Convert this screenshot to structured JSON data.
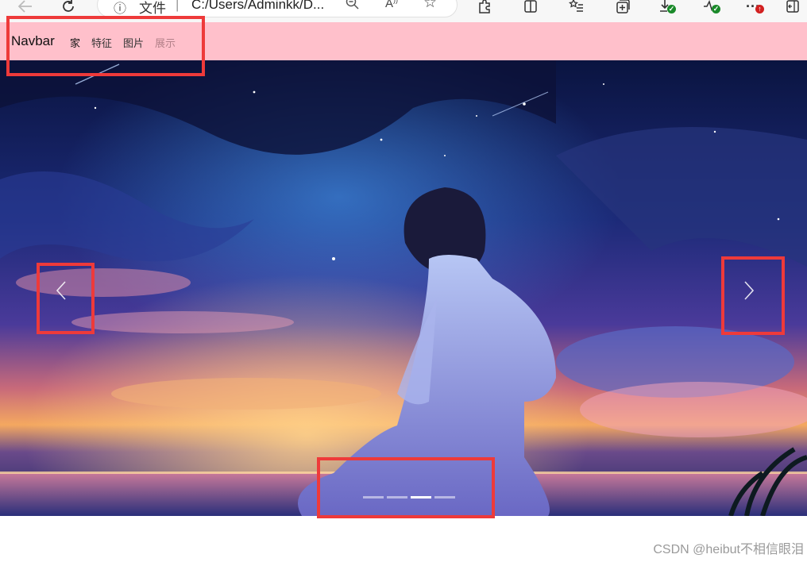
{
  "browser": {
    "address_file_label": "文件",
    "address_separator": "|",
    "address_url": "C:/Users/Adminkk/D...",
    "icons": [
      "back-arrow-icon",
      "refresh-icon",
      "info-icon",
      "zoom-out-icon",
      "read-aloud-icon",
      "favorite-star-icon",
      "extensions-icon",
      "split-screen-icon",
      "favorites-list-icon",
      "collections-icon",
      "downloads-icon",
      "performance-icon",
      "more-options-icon",
      "sidebar-toggle-icon"
    ],
    "badge_colors": {
      "green": "#1a8a2a",
      "red": "#d22020"
    }
  },
  "navbar": {
    "brand": "Navbar",
    "items": [
      {
        "label": "家",
        "state": "active"
      },
      {
        "label": "特征",
        "state": "normal"
      },
      {
        "label": "图片",
        "state": "normal"
      },
      {
        "label": "展示",
        "state": "disabled"
      }
    ],
    "background": "#ffc0cb"
  },
  "carousel": {
    "prev_icon": "chevron-left-icon",
    "next_icon": "chevron-right-icon",
    "indicator_count": 4,
    "active_indicator": 3
  },
  "annotation": {
    "box_color": "#ee3a3a"
  },
  "watermark": "CSDN @heibut不相信眼泪"
}
